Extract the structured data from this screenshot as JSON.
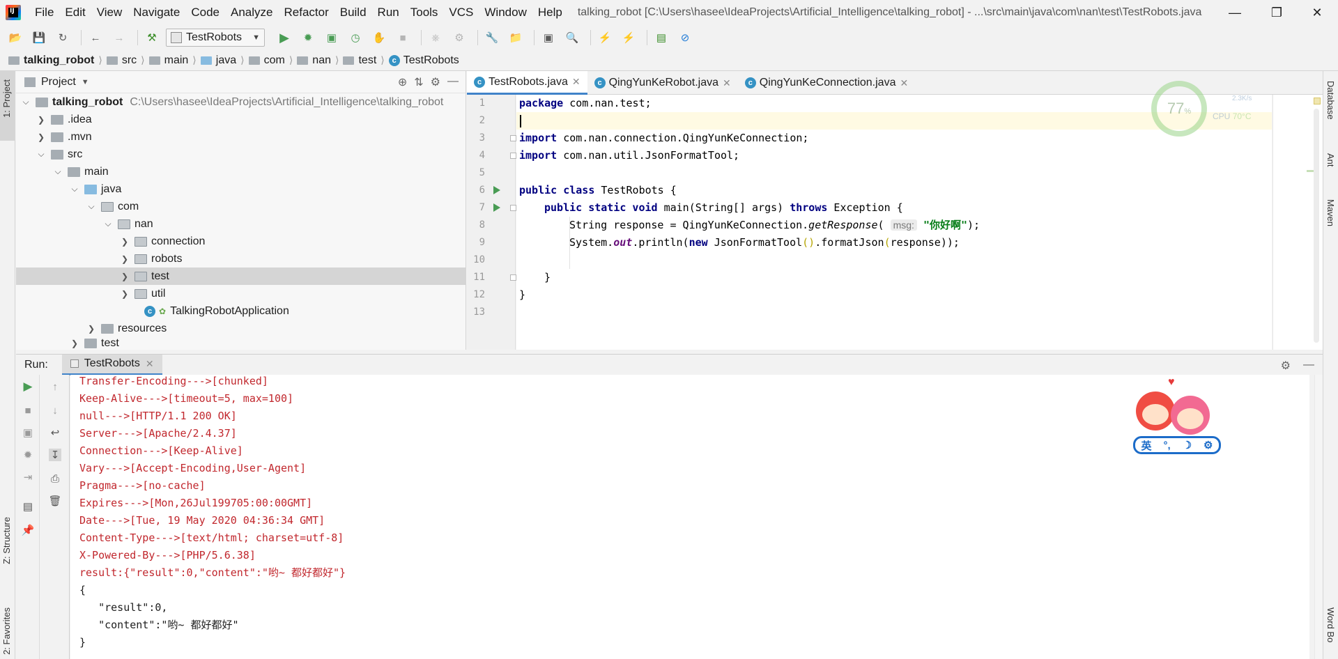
{
  "app": {
    "window_title": "talking_robot [C:\\Users\\hasee\\IdeaProjects\\Artificial_Intelligence\\talking_robot] - ...\\src\\main\\java\\com\\nan\\test\\TestRobots.java",
    "logo_text": "IJ"
  },
  "menu": [
    "File",
    "Edit",
    "View",
    "Navigate",
    "Code",
    "Analyze",
    "Refactor",
    "Build",
    "Run",
    "Tools",
    "VCS",
    "Window",
    "Help"
  ],
  "toolbar": {
    "run_config": "TestRobots"
  },
  "breadcrumb": [
    "talking_robot",
    "src",
    "main",
    "java",
    "com",
    "nan",
    "test",
    "TestRobots"
  ],
  "left_stripe": {
    "project_tab": "1: Project",
    "structure_tab": "Z: Structure",
    "favorites_tab": "2: Favorites"
  },
  "right_stripe": {
    "database_tab": "Database",
    "ant_tab": "Ant",
    "maven_tab": "Maven",
    "wordbook_tab": "Word Bo"
  },
  "project": {
    "title": "Project",
    "tree": [
      {
        "label": "talking_robot",
        "path": "C:\\Users\\hasee\\IdeaProjects\\Artificial_Intelligence\\talking_robot"
      },
      {
        "label": ".idea"
      },
      {
        "label": ".mvn"
      },
      {
        "label": "src"
      },
      {
        "label": "main"
      },
      {
        "label": "java"
      },
      {
        "label": "com"
      },
      {
        "label": "nan"
      },
      {
        "label": "connection"
      },
      {
        "label": "robots"
      },
      {
        "label": "test"
      },
      {
        "label": "util"
      },
      {
        "label": "TalkingRobotApplication"
      },
      {
        "label": "resources"
      },
      {
        "label": "test"
      }
    ]
  },
  "editor": {
    "tabs": [
      "TestRobots.java",
      "QingYunKeRobot.java",
      "QingYunKeConnection.java"
    ],
    "line_numbers": [
      "1",
      "2",
      "3",
      "4",
      "5",
      "6",
      "7",
      "8",
      "9",
      "10",
      "11",
      "12",
      "13"
    ],
    "code": {
      "l1_kw": "package",
      "l1_rest": " com.nan.test;",
      "l3_kw": "import",
      "l3_rest": " com.nan.connection.QingYunKeConnection;",
      "l4_kw": "import",
      "l4_rest": " com.nan.util.JsonFormatTool;",
      "l6_kw": "public class",
      "l6_rest": " TestRobots {",
      "l7_kw1": "public static void",
      "l7_mid": " main(String[] args) ",
      "l7_kw2": "throws",
      "l7_rest": " Exception {",
      "l8_pre": "String response = QingYunKeConnection.",
      "l8_method": "getResponse",
      "l8_open": "(",
      "l8_hint": "msg:",
      "l8_str": "\"你好啊\"",
      "l8_close": ");",
      "l9_pre": "System.",
      "l9_out": "out",
      "l9_mid": ".println(",
      "l9_new": "new",
      "l9_rest1": " JsonFormatTool",
      "l9_parens": "()",
      "l9_rest2": ".formatJson",
      "l9_open": "(",
      "l9_arg": "response",
      "l9_close": "));",
      "l11": "}",
      "l12": "}"
    }
  },
  "cpu_widget": {
    "percent": "77",
    "percent_unit": "%",
    "net_speed": "2.3K/s",
    "cpu_label": "CPU",
    "cpu_temp": "70°C"
  },
  "run": {
    "label": "Run:",
    "tab": "TestRobots",
    "console": [
      "Transfer-Encoding--->[chunked]",
      "Keep-Alive--->[timeout=5, max=100]",
      "null--->[HTTP/1.1 200 OK]",
      "Server--->[Apache/2.4.37]",
      "Connection--->[Keep-Alive]",
      "Vary--->[Accept-Encoding,User-Agent]",
      "Pragma--->[no-cache]",
      "Expires--->[Mon,26Jul199705:00:00GMT]",
      "Date--->[Tue, 19 May 2020 04:36:34 GMT]",
      "Content-Type--->[text/html; charset=utf-8]",
      "X-Powered-By--->[PHP/5.6.38]",
      "result:{\"result\":0,\"content\":\"哟~ 都好都好\"}"
    ],
    "json_output": [
      "{",
      "   \"result\":0,",
      "   \"content\":\"哟~ 都好都好\"",
      "}"
    ]
  },
  "ime": {
    "mode": "英",
    "punct": "°,",
    "moon": "☽",
    "gear": "⚙"
  },
  "colors": {
    "accent": "#4083c9",
    "run_green": "#499c54",
    "console_red": "#c1272d"
  }
}
